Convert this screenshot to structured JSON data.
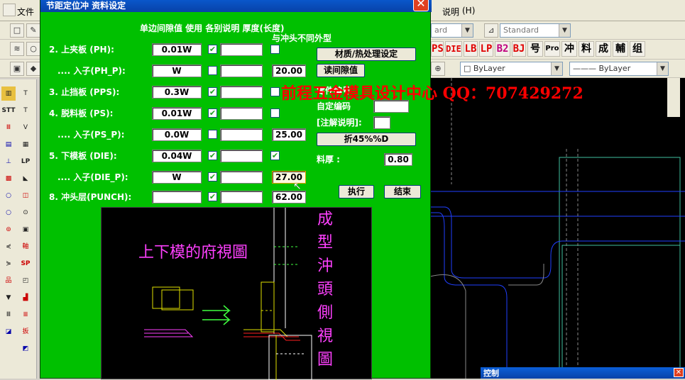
{
  "menu": {
    "file": "文件",
    "help": "说明",
    "help_key": "(H)"
  },
  "toolbar": {
    "text_style_value": "Standard",
    "dim_style_value": "Standard",
    "layer_value": "ByLayer",
    "linetype_value": "ByLayer",
    "partial_combo_value": "ard",
    "red_tools": [
      "PS",
      "DIE",
      "LB",
      "LP",
      "B2",
      "BJ"
    ],
    "black_tools": [
      "号",
      "冲",
      "料",
      "成",
      "輔",
      "组"
    ],
    "pro_tool": "Pro"
  },
  "left_tools": [
    "STT",
    "LP",
    "SP"
  ],
  "dialog": {
    "title": "节距定位冲  资料设定",
    "close": "✕",
    "header_line1": "单边间隙值  使用  各别说明  厚度(长度)",
    "header_line2": "与冲头不同外型",
    "rows": [
      {
        "label": "2.   上夹板  (PH):",
        "value": "0.01W",
        "use": true,
        "thick": "",
        "has_small_chk": true
      },
      {
        "label": "....  入子(PH_P):",
        "value": "W",
        "use": false,
        "thick": "20.00"
      },
      {
        "label": "3.   止挡板 (PPS):",
        "value": "0.3W",
        "use": true,
        "thick": "",
        "has_small_chk": true
      },
      {
        "label": "4.   脱料板   (PS):",
        "value": "0.01W",
        "use": true,
        "thick": "",
        "has_small_chk": true
      },
      {
        "label": "....  入子(PS_P):",
        "value": "0.0W",
        "use": false,
        "thick": "25.00"
      },
      {
        "label": "5.   下模板 (DIE):",
        "value": "0.04W",
        "use": true,
        "thick": "",
        "has_small_chk": true,
        "small_checked": true
      },
      {
        "label": "....  入子(DIE_P):",
        "value": "W",
        "use": true,
        "thick": "27.00"
      },
      {
        "label": "8.  冲头层(PUNCH):",
        "value": "",
        "use": true,
        "thick": "62.00"
      }
    ],
    "btn_material": "材质/热处理设定",
    "btn_read": "读间隙值",
    "label_part": "零件编号",
    "label_custom": "自定编码",
    "label_note": "[注解说明]:",
    "btn_fold": "折45%%D",
    "label_thickness": "料厚 :",
    "thickness_value": "0.80",
    "btn_exec": "执行",
    "btn_end": "结束"
  },
  "preview": {
    "top_view_text": "上下模的府視圖",
    "side_view_text": [
      "成",
      "型",
      "沖",
      "頭",
      "側",
      "視",
      "圖"
    ]
  },
  "watermark": "前程五金模具设计中心  QQ：707429272",
  "control_bar_title": "控制"
}
